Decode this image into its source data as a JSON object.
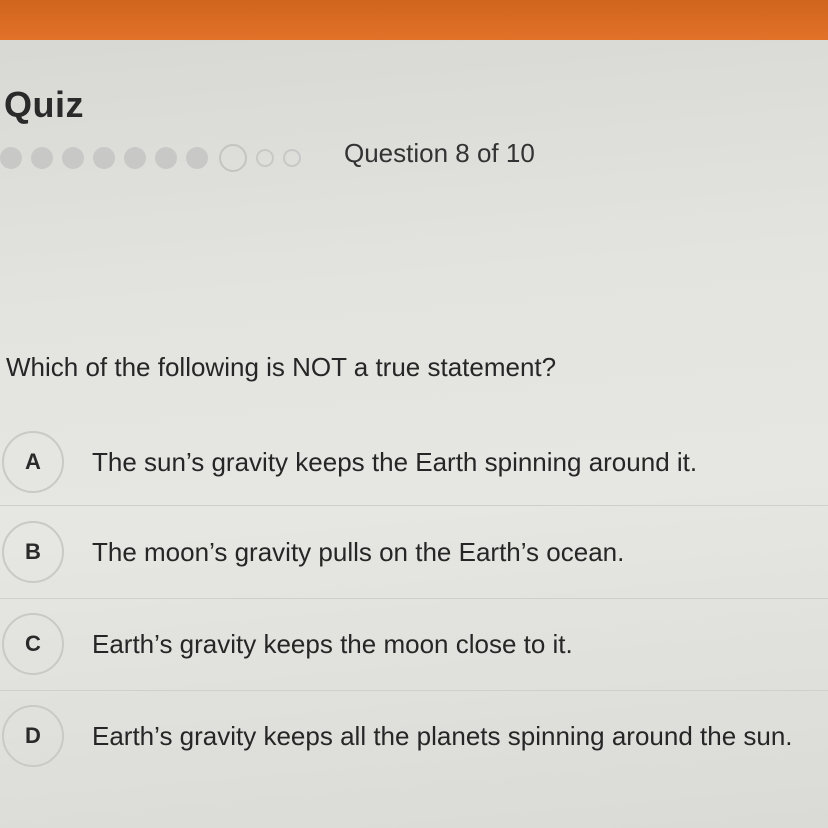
{
  "header": {
    "accent_color": "#e27128"
  },
  "quiz": {
    "title": "Quiz",
    "progress": {
      "completed": 7,
      "current": 8,
      "total": 10
    },
    "question_count": "Question 8 of 10",
    "question": "Which of the following is NOT a true statement?",
    "options": [
      {
        "letter": "A",
        "text": "The sun’s gravity keeps the Earth spinning around it."
      },
      {
        "letter": "B",
        "text": "The moon’s gravity pulls on the Earth’s ocean."
      },
      {
        "letter": "C",
        "text": "Earth’s gravity keeps the moon close to it."
      },
      {
        "letter": "D",
        "text": "Earth’s gravity keeps all the planets spinning around the sun."
      }
    ]
  }
}
